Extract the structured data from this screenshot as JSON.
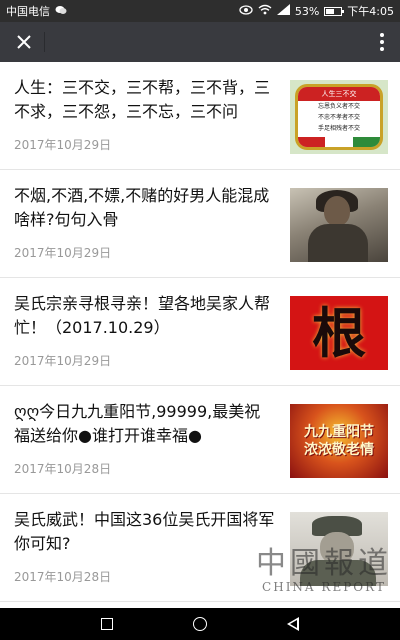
{
  "status_bar": {
    "carrier": "中国电信",
    "battery_percent": "53%",
    "battery_level": 0.53,
    "time": "下午4:05",
    "icons": [
      "eye-icon",
      "wifi-icon",
      "signal-icon",
      "battery-icon"
    ]
  },
  "title_bar": {
    "close_icon": "close-icon",
    "more_icon": "more-vertical-icon"
  },
  "articles": [
    {
      "title": "人生：三不交，三不帮，三不背，三不求，三不怨，三不忘，三不问",
      "date": "2017年10月29日",
      "thumb": {
        "kind": "badge",
        "header": "人生三不交",
        "lines": [
          "忘恩负义者不交",
          "不忠不孝者不交",
          "手足相残者不交"
        ]
      }
    },
    {
      "title": "不烟,不酒,不嫖,不赌的好男人能混成啥样?句句入骨",
      "date": "2017年10月29日",
      "thumb": {
        "kind": "photo"
      }
    },
    {
      "title": "吴氏宗亲寻根寻亲！望各地吴家人帮忙！（2017.10.29）",
      "date": "2017年10月29日",
      "thumb": {
        "kind": "gen",
        "char": "根"
      }
    },
    {
      "title": "ღღ今日九九重阳节,99999,最美祝福送给你●谁打开谁幸福●",
      "date": "2017年10月28日",
      "thumb": {
        "kind": "festival",
        "lines": [
          "九九重阳节",
          "浓浓敬老情"
        ]
      }
    },
    {
      "title": "吴氏威武！中国这36位吴氏开国将军你可知?",
      "date": "2017年10月28日",
      "thumb": {
        "kind": "general"
      }
    }
  ],
  "watermark": {
    "cn": "中國報道",
    "en": "CHINA REPORT"
  },
  "nav_bar": {
    "icons": [
      "recent-apps-icon",
      "home-icon",
      "back-icon"
    ]
  }
}
